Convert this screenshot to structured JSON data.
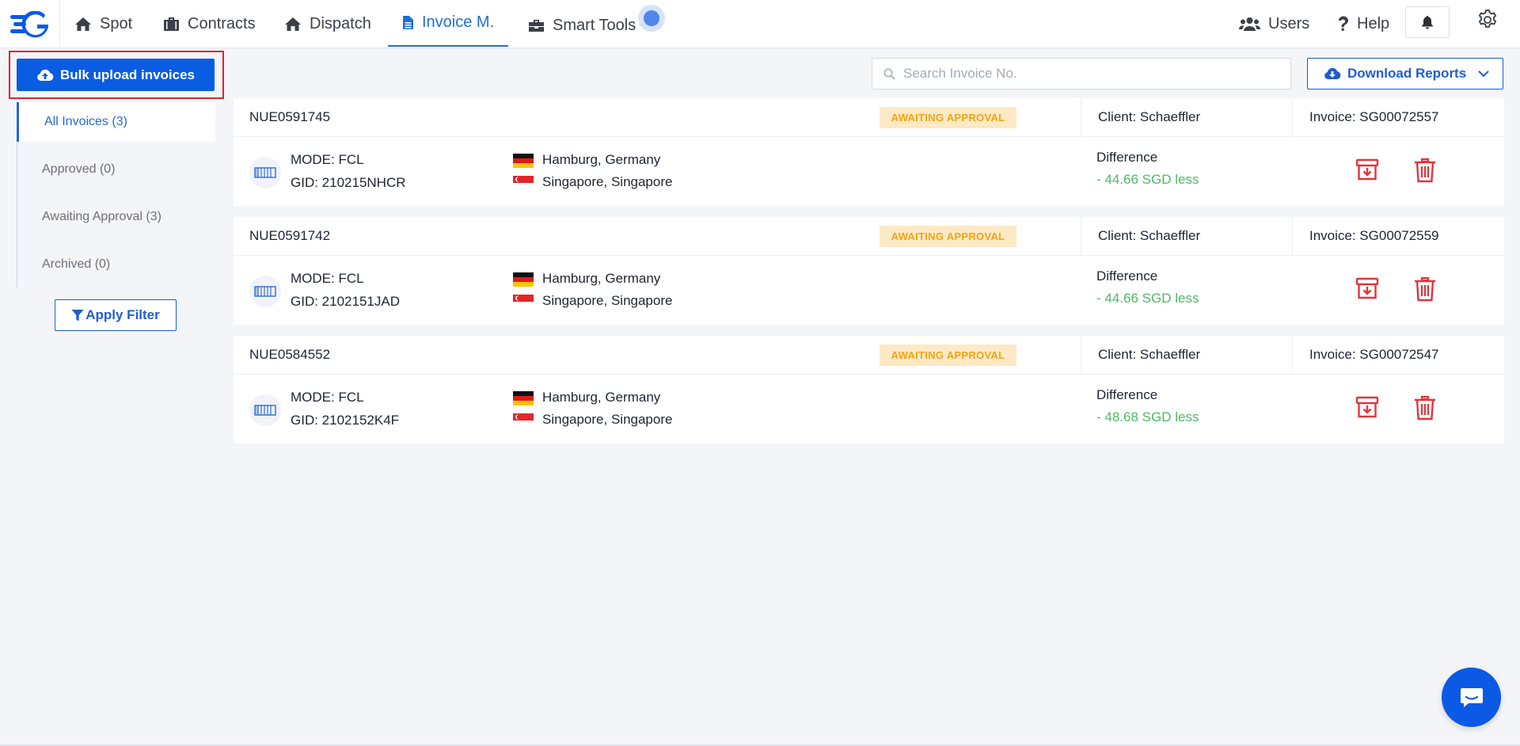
{
  "nav": {
    "items": [
      {
        "label": "Spot",
        "icon": "home-icon"
      },
      {
        "label": "Contracts",
        "icon": "suitcase-icon"
      },
      {
        "label": "Dispatch",
        "icon": "home-icon"
      },
      {
        "label": "Invoice M.",
        "icon": "document-icon",
        "active": true
      },
      {
        "label": "Smart Tools",
        "icon": "toolbox-icon"
      }
    ],
    "users_label": "Users",
    "help_label": "Help"
  },
  "sidebar": {
    "bulk_upload_label": "Bulk upload invoices",
    "filters": [
      {
        "label": "All Invoices (3)",
        "active": true
      },
      {
        "label": "Approved (0)"
      },
      {
        "label": "Awaiting Approval (3)"
      },
      {
        "label": "Archived (0)"
      }
    ],
    "apply_filter_label": "Apply Filter"
  },
  "search": {
    "placeholder": "Search Invoice No.",
    "value": ""
  },
  "download_reports_label": "Download Reports",
  "invoices": [
    {
      "number": "NUE0591745",
      "status": "AWAITING APPROVAL",
      "client": "Client: Schaeffler",
      "invoice": "Invoice: SG00072557",
      "mode": "MODE: FCL",
      "gid": "GID: 210215NHCR",
      "origin": "Hamburg, Germany",
      "destination": "Singapore, Singapore",
      "difference_label": "Difference",
      "difference": "- 44.66 SGD less"
    },
    {
      "number": "NUE0591742",
      "status": "AWAITING APPROVAL",
      "client": "Client: Schaeffler",
      "invoice": "Invoice: SG00072559",
      "mode": "MODE: FCL",
      "gid": "GID: 2102151JAD",
      "origin": "Hamburg, Germany",
      "destination": "Singapore, Singapore",
      "difference_label": "Difference",
      "difference": "- 44.66 SGD less"
    },
    {
      "number": "NUE0584552",
      "status": "AWAITING APPROVAL",
      "client": "Client: Schaeffler",
      "invoice": "Invoice: SG00072547",
      "mode": "MODE: FCL",
      "gid": "GID: 2102152K4F",
      "origin": "Hamburg, Germany",
      "destination": "Singapore, Singapore",
      "difference_label": "Difference",
      "difference": "- 48.68 SGD less"
    }
  ],
  "colors": {
    "primary": "#0a5ce3",
    "active_nav": "#1f6fd8",
    "badge_bg": "#fde9c4",
    "badge_text": "#f3a412",
    "difference": "#4cba63",
    "action_red": "#e0363c",
    "highlight_outline": "#e0242f"
  }
}
